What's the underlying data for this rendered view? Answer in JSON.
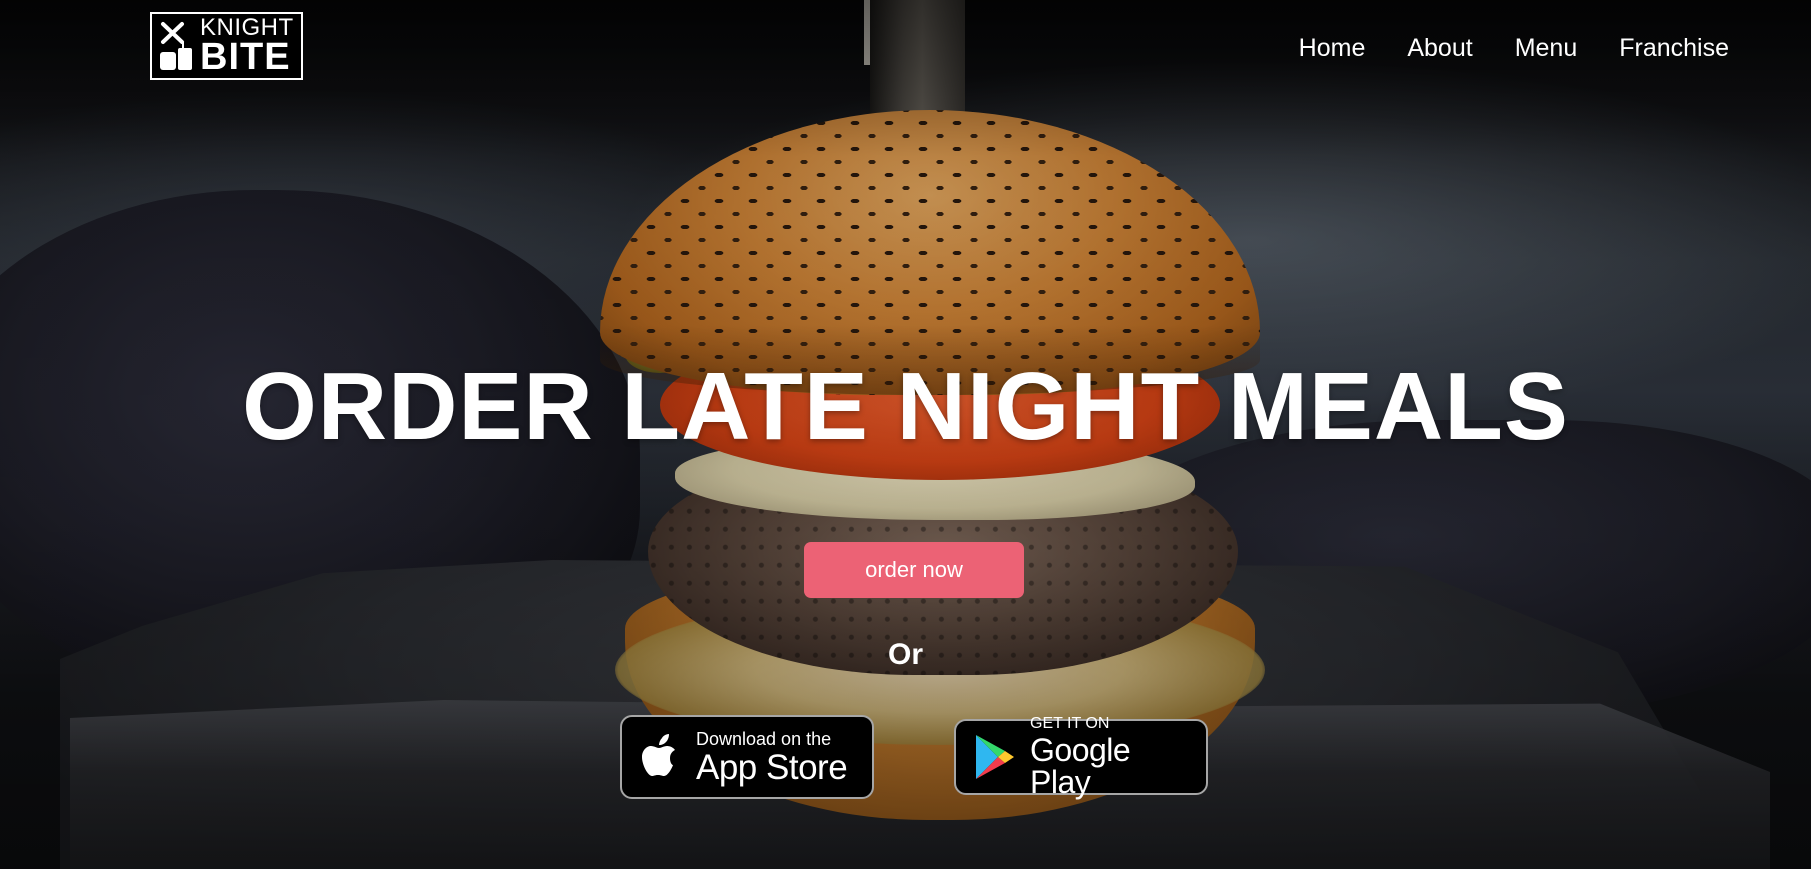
{
  "brand": {
    "logo_line1": "KNIGHT",
    "logo_line2": "BITE"
  },
  "nav": {
    "items": [
      {
        "label": "Home"
      },
      {
        "label": "About"
      },
      {
        "label": "Menu"
      },
      {
        "label": "Franchise"
      }
    ]
  },
  "hero": {
    "headline": "ORDER LATE NIGHT MEALS",
    "cta_label": "order now",
    "separator": "Or",
    "app_store": {
      "small": "Download on the",
      "big": "App Store",
      "icon": "apple-icon"
    },
    "google_play": {
      "small": "GET IT ON",
      "big": "Google Play",
      "icon": "google-play-icon"
    }
  },
  "colors": {
    "cta": "#ec6275",
    "text": "#ffffff",
    "store_badge": "#000000"
  }
}
